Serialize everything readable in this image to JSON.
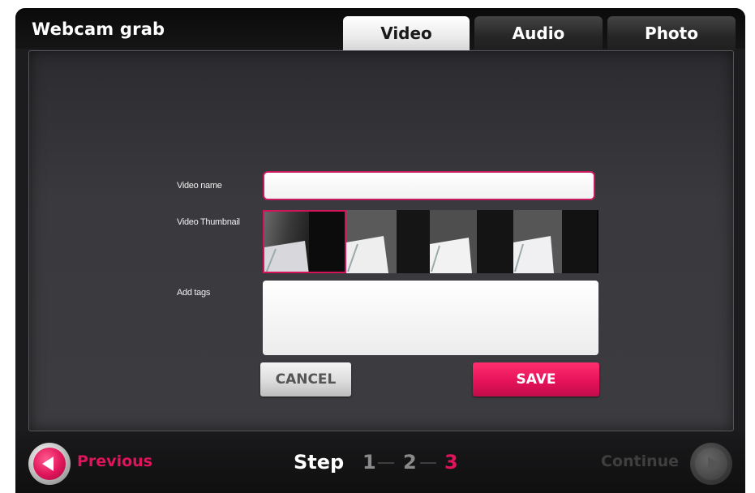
{
  "app": {
    "title": "Webcam grab"
  },
  "tabs": [
    {
      "label": "Video",
      "active": true
    },
    {
      "label": "Audio",
      "active": false
    },
    {
      "label": "Photo",
      "active": false
    }
  ],
  "form": {
    "video_name_label": "Video name",
    "video_name_value": "",
    "thumbnail_label": "Video Thumbnail",
    "thumbnail_selected_index": 0,
    "thumbnail_count": 4,
    "tags_label": "Add tags",
    "tags_value": "",
    "cancel_label": "CANCEL",
    "save_label": "SAVE"
  },
  "footer": {
    "previous_label": "Previous",
    "step_label": "Step",
    "steps": [
      "1",
      "2",
      "3"
    ],
    "current_step": "3",
    "continue_label": "Continue"
  },
  "colors": {
    "accent": "#e0145a",
    "background": "#1c1c1e",
    "panel": "#3a3a3e"
  },
  "icons": {
    "previous": "left-arrow-circle-icon",
    "continue": "right-arrow-circle-icon"
  }
}
